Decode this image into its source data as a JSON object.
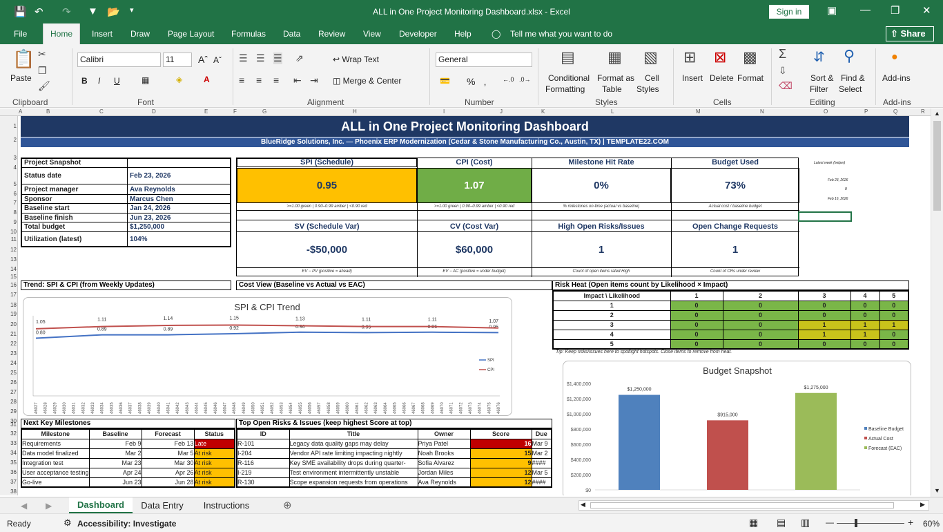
{
  "app": {
    "window_title": "ALL in One Project Monitoring Dashboard.xlsx  -  Excel",
    "sign_in": "Sign in",
    "share": "Share"
  },
  "menu": [
    "File",
    "Home",
    "Insert",
    "Draw",
    "Page Layout",
    "Formulas",
    "Data",
    "Review",
    "View",
    "Developer",
    "Help"
  ],
  "tell_me": "Tell me what you want to do",
  "ribbon": {
    "font_name": "Calibri",
    "font_size": "11",
    "number_format": "General",
    "wrap_text": "Wrap Text",
    "merge_center": "Merge & Center",
    "paste": "Paste",
    "cond_format": "Conditional",
    "cond_format2": "Formatting",
    "format_table": "Format as",
    "format_table2": "Table",
    "cell_styles": "Cell",
    "cell_styles2": "Styles",
    "insert": "Insert",
    "delete": "Delete",
    "format": "Format",
    "sort": "Sort &",
    "sort2": "Filter",
    "find": "Find &",
    "find2": "Select",
    "addins": "Add-ins",
    "groups": [
      "Clipboard",
      "Font",
      "Alignment",
      "Number",
      "Styles",
      "Cells",
      "Editing",
      "Add-ins"
    ]
  },
  "columns": [
    "A",
    "B",
    "C",
    "D",
    "E",
    "F",
    "G",
    "H",
    "I",
    "J",
    "K",
    "L",
    "M",
    "N",
    "O",
    "P",
    "Q",
    "R"
  ],
  "rows": [
    "1",
    "2",
    "3",
    "4",
    "5",
    "6",
    "7",
    "8",
    "9",
    "10",
    "11",
    "12",
    "13",
    "14",
    "15",
    "16",
    "17",
    "18",
    "19",
    "20",
    "21",
    "22",
    "23",
    "24",
    "25",
    "26",
    "27",
    "28",
    "29",
    "30",
    "31",
    "32",
    "33",
    "34",
    "35",
    "36",
    "37",
    "38"
  ],
  "dashboard": {
    "title": "ALL in One Project Monitoring Dashboard",
    "subtitle": "BlueRidge Solutions, Inc. — Phoenix ERP Modernization (Cedar & Stone Manufacturing Co., Austin, TX)  |  TEMPLATE22.COM",
    "snapshot": {
      "header": "Project Snapshot",
      "rows": [
        {
          "k": "Status date",
          "v": "Feb 23, 2026"
        },
        {
          "k": "Project manager",
          "v": "Ava Reynolds"
        },
        {
          "k": "Sponsor",
          "v": "Marcus Chen"
        },
        {
          "k": "Baseline start",
          "v": "Jan 24, 2026"
        },
        {
          "k": "Baseline finish",
          "v": "Jun 23, 2026"
        },
        {
          "k": "Total budget",
          "v": "$1,250,000"
        },
        {
          "k": "Utilization (latest)",
          "v": "104%"
        }
      ]
    },
    "kpis_top": [
      {
        "h": "SPI (Schedule)",
        "v": "0.95",
        "n": ">=1.00 green | 0.90–0.99 amber | <0.90 red",
        "bg": "#ffc000"
      },
      {
        "h": "CPI (Cost)",
        "v": "1.07",
        "n": ">=1.00 green | 0.90–0.99 amber | <0.90 red",
        "bg": "#70ad47"
      },
      {
        "h": "Milestone Hit Rate",
        "v": "0%",
        "n": "% milestones on-time (actual vs baseline)",
        "bg": "#ffffff"
      },
      {
        "h": "Budget Used",
        "v": "73%",
        "n": "Actual cost / baseline budget",
        "bg": "#ffffff"
      }
    ],
    "kpis_bottom": [
      {
        "h": "SV (Schedule Var)",
        "v": "-$50,000",
        "n": "EV − PV (positive = ahead)"
      },
      {
        "h": "CV (Cost Var)",
        "v": "$60,000",
        "n": "EV − AC (positive = under budget)"
      },
      {
        "h": "High Open Risks/Issues",
        "v": "1",
        "n": "Count of open items rated High"
      },
      {
        "h": "Open Change Requests",
        "v": "1",
        "n": "Count of CRs under review"
      }
    ],
    "side_notes": [
      "Latest week (helper)",
      "Feb 23, 2026",
      "8",
      "Feb 16, 2026"
    ],
    "sections": {
      "trend": "Trend: SPI & CPI (from Weekly Updates)",
      "cost": "Cost View (Baseline vs Actual vs EAC)",
      "risk": "Risk Heat (Open items count by Likelihood × Impact)",
      "milestones": "Next Key Milestones",
      "risks": "Top Open Risks & Issues (keep highest Score at top)"
    },
    "risk_heat": {
      "corner": "Impact \\ Likelihood",
      "cols": [
        "1",
        "2",
        "3",
        "4",
        "5"
      ],
      "rows": [
        {
          "l": "1",
          "v": [
            "0",
            "0",
            "0",
            "0",
            "0"
          ]
        },
        {
          "l": "2",
          "v": [
            "0",
            "0",
            "0",
            "0",
            "0"
          ]
        },
        {
          "l": "3",
          "v": [
            "0",
            "0",
            "1",
            "1",
            "1"
          ]
        },
        {
          "l": "4",
          "v": [
            "0",
            "0",
            "1",
            "1",
            "0"
          ]
        },
        {
          "l": "5",
          "v": [
            "0",
            "0",
            "0",
            "0",
            "0"
          ]
        }
      ],
      "tip": "Tip: Keep risks/issues here to spotlight hotspots. Close items to remove from heat."
    },
    "milestones": {
      "headers": [
        "Milestone",
        "Baseline",
        "Forecast",
        "Status"
      ],
      "rows": [
        {
          "m": "Requirements",
          "b": "Feb 9",
          "f": "Feb 13",
          "s": "Late",
          "c": "#c00000"
        },
        {
          "m": "Data model finalized",
          "b": "Mar 2",
          "f": "Mar 5",
          "s": "At risk",
          "c": "#ffc000"
        },
        {
          "m": "Integration test",
          "b": "Mar 23",
          "f": "Mar 30",
          "s": "At risk",
          "c": "#ffc000"
        },
        {
          "m": "User acceptance testing",
          "b": "Apr 24",
          "f": "Apr 26",
          "s": "At risk",
          "c": "#ffc000"
        },
        {
          "m": "Go-live",
          "b": "Jun 23",
          "f": "Jun 28",
          "s": "At risk",
          "c": "#ffc000"
        }
      ]
    },
    "risks": {
      "headers": [
        "ID",
        "Title",
        "Owner",
        "Score",
        "Due"
      ],
      "rows": [
        {
          "id": "R-101",
          "t": "Legacy data quality gaps may delay",
          "o": "Priya Patel",
          "s": "16",
          "d": "Mar 9",
          "c": "#c00000"
        },
        {
          "id": "I-204",
          "t": "Vendor API rate limiting impacting nightly",
          "o": "Noah Brooks",
          "s": "15",
          "d": "Mar 2",
          "c": "#ffc000"
        },
        {
          "id": "R-116",
          "t": "Key SME availability drops during quarter-",
          "o": "Sofia Alvarez",
          "s": "9",
          "d": "####",
          "c": "#ffc000"
        },
        {
          "id": "I-219",
          "t": "Test environment intermittently unstable",
          "o": "Jordan Miles",
          "s": "12",
          "d": "Mar 5",
          "c": "#ffc000"
        },
        {
          "id": "R-130",
          "t": "Scope expansion requests from operations",
          "o": "Ava Reynolds",
          "s": "12",
          "d": "####",
          "c": "#ffc000"
        }
      ]
    }
  },
  "chart_data": [
    {
      "type": "line",
      "title": "SPI & CPI Trend",
      "x": [
        "46027",
        "46028",
        "46029",
        "46030",
        "46031",
        "46032",
        "46033",
        "46034",
        "46035",
        "46036",
        "46037",
        "46038",
        "46039",
        "46040",
        "46041",
        "46042",
        "46043",
        "46044",
        "46045",
        "46046",
        "46047",
        "46048",
        "46049",
        "46050",
        "46051",
        "46052",
        "46053",
        "46054",
        "46055",
        "46056",
        "46057",
        "46058",
        "46059",
        "46060",
        "46061",
        "46062",
        "46063",
        "46064",
        "46065",
        "46066",
        "46067",
        "46068",
        "46069",
        "46070",
        "46071",
        "46072",
        "46073",
        "46074",
        "46075",
        "46076"
      ],
      "series": [
        {
          "name": "SPI",
          "color": "#4472c4",
          "points": [
            [
              46027,
              0.8
            ],
            [
              46034,
              0.89
            ],
            [
              46041,
              0.89
            ],
            [
              46048,
              0.92
            ],
            [
              46055,
              0.96
            ],
            [
              46062,
              0.95
            ],
            [
              46069,
              0.96
            ],
            [
              46076,
              0.95
            ]
          ]
        },
        {
          "name": "CPI",
          "color": "#c0504d",
          "points": [
            [
              46027,
              1.05
            ],
            [
              46034,
              1.11
            ],
            [
              46041,
              1.14
            ],
            [
              46048,
              1.15
            ],
            [
              46055,
              1.13
            ],
            [
              46062,
              1.11
            ],
            [
              46069,
              1.11
            ],
            [
              46076,
              1.07
            ]
          ]
        }
      ],
      "ylim": [
        0.0,
        1.25
      ]
    },
    {
      "type": "bar",
      "title": "Budget Snapshot",
      "categories": [
        "Baseline Budget",
        "Actual Cost",
        "Forecast (EAC)"
      ],
      "values": [
        1250000,
        915000,
        1275000
      ],
      "labels": [
        "$1,250,000",
        "$915,000",
        "$1,275,000"
      ],
      "colors": [
        "#4f81bd",
        "#c0504d",
        "#9bbb59"
      ],
      "ylim": [
        0,
        1400000
      ],
      "yticks": [
        "$0",
        "$200,000",
        "$400,000",
        "$600,000",
        "$800,000",
        "$1,000,000",
        "$1,200,000",
        "$1,400,000"
      ]
    }
  ],
  "sheet_tabs": [
    "Dashboard",
    "Data Entry",
    "Instructions"
  ],
  "status": {
    "ready": "Ready",
    "accessibility": "Accessibility: Investigate",
    "zoom": "60%"
  }
}
